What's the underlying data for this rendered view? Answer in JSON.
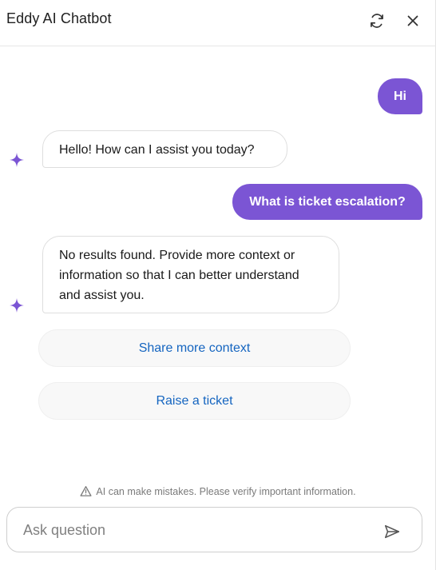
{
  "header": {
    "title": "Eddy AI Chatbot",
    "refresh_icon": "refresh-icon",
    "close_icon": "close-icon"
  },
  "messages": [
    {
      "role": "user",
      "text": "Hi"
    },
    {
      "role": "bot",
      "text": "Hello! How can I assist you today?"
    },
    {
      "role": "user",
      "text": "What is ticket escalation?"
    },
    {
      "role": "bot",
      "text": "No results found. Provide more context or information so that I can better understand and assist you."
    }
  ],
  "actions": {
    "share_context": "Share more context",
    "raise_ticket": "Raise a ticket"
  },
  "disclaimer": {
    "icon": "warning-icon",
    "text": "AI can make mistakes. Please verify important information."
  },
  "input": {
    "value": "",
    "placeholder": "Ask question",
    "send_icon": "send-icon"
  },
  "colors": {
    "accent": "#7b55d4",
    "link": "#1565c0",
    "sparkle": "#7b55d4"
  }
}
